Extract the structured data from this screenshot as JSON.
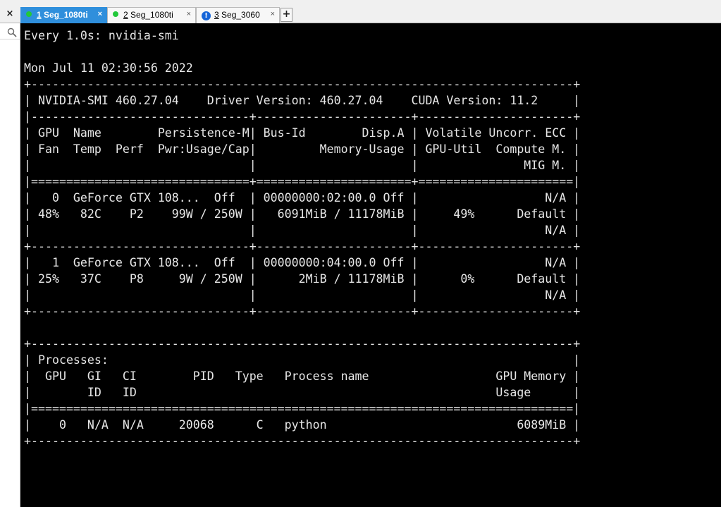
{
  "tabs": [
    {
      "num": "1",
      "label": "Seg_1080ti",
      "status": "connected",
      "active": true
    },
    {
      "num": "2",
      "label": "Seg_1080ti",
      "status": "connected",
      "active": false
    },
    {
      "num": "3",
      "label": "Seg_3060",
      "status": "warning",
      "active": false
    }
  ],
  "tab_close_glyph": "×",
  "new_tab_glyph": "+",
  "panel_close_glyph": "×",
  "terminal": {
    "lines": [
      "Every 1.0s: nvidia-smi",
      "",
      "Mon Jul 11 02:30:56 2022",
      "+-----------------------------------------------------------------------------+",
      "| NVIDIA-SMI 460.27.04    Driver Version: 460.27.04    CUDA Version: 11.2     |",
      "|-------------------------------+----------------------+----------------------+",
      "| GPU  Name        Persistence-M| Bus-Id        Disp.A | Volatile Uncorr. ECC |",
      "| Fan  Temp  Perf  Pwr:Usage/Cap|         Memory-Usage | GPU-Util  Compute M. |",
      "|                               |                      |               MIG M. |",
      "|===============================+======================+======================|",
      "|   0  GeForce GTX 108...  Off  | 00000000:02:00.0 Off |                  N/A |",
      "| 48%   82C    P2    99W / 250W |   6091MiB / 11178MiB |     49%      Default |",
      "|                               |                      |                  N/A |",
      "+-------------------------------+----------------------+----------------------+",
      "|   1  GeForce GTX 108...  Off  | 00000000:04:00.0 Off |                  N/A |",
      "| 25%   37C    P8     9W / 250W |      2MiB / 11178MiB |      0%      Default |",
      "|                               |                      |                  N/A |",
      "+-------------------------------+----------------------+----------------------+",
      "",
      "+-----------------------------------------------------------------------------+",
      "| Processes:                                                                  |",
      "|  GPU   GI   CI        PID   Type   Process name                  GPU Memory |",
      "|        ID   ID                                                   Usage      |",
      "|=============================================================================|",
      "|    0   N/A  N/A     20068      C   python                           6089MiB |",
      "+-----------------------------------------------------------------------------+"
    ]
  }
}
